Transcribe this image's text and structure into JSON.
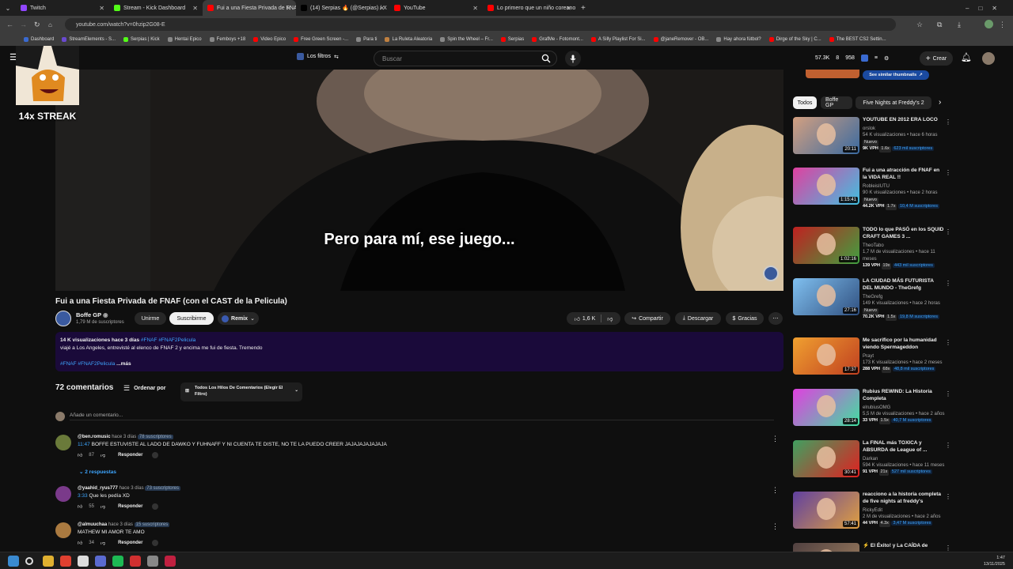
{
  "browser": {
    "tabs": [
      {
        "label": "Twitch",
        "color": "#9146ff"
      },
      {
        "label": "Stream - Kick Dashboard",
        "color": "#53fc18"
      },
      {
        "label": "Fui a una Fiesta Privada de FNAF",
        "color": "#ff0000",
        "active": true
      },
      {
        "label": "(14) Serpias 🔥 (@Serpias) / X",
        "color": "#000000"
      },
      {
        "label": "YouTube",
        "color": "#ff0000"
      },
      {
        "label": "Lo primero que un niño coreano",
        "color": "#ff0000"
      }
    ],
    "url": "youtube.com/watch?v=0hzip2G08-E",
    "bookmarks": [
      "Dashboard",
      "StreamElements - S...",
      "Serpias | Kick",
      "Hentai Epico",
      "Femboys +18",
      "Video Epico",
      "Free Green Screen -...",
      "Para ti",
      "La Ruleta Aleatoria",
      "Spin the Wheel – Fr...",
      "Serpias",
      "GrafMe - Fotomont...",
      "A Silly Playlist For Si...",
      "@janeRemover - OB...",
      "Hay ahora fútbol?",
      "Dirge of the Sky | C...",
      "The BEST CS2 Settin..."
    ]
  },
  "header": {
    "filters": "Los filtros",
    "search_placeholder": "Buscar",
    "stats": {
      "views": "57.3K",
      "n1": "8",
      "n2": "958"
    },
    "create": "Crear"
  },
  "overlay": {
    "streak": "14x STREAK"
  },
  "video": {
    "subtitle": "Pero para mí, ese juego...",
    "title": "Fui a una Fiesta Privada de FNAF (con el CAST de la Pelicula)"
  },
  "channel": {
    "name": "Boffe GP",
    "subs": "1,79 M de suscriptores",
    "join": "Unirme",
    "subscribe": "Suscribirme",
    "remix": "Remix"
  },
  "actions": {
    "likes": "1,6 K",
    "share": "Compartir",
    "download": "Descargar",
    "thanks": "Gracias"
  },
  "description": {
    "views": "14 K visualizaciones",
    "date": "hace 3 días",
    "tags_top": "#FNAF #FNAF2Pelicula",
    "text": "viajé a Los Angeles, entrevisté al elenco de FNAF 2 y encima me fui de fiesta. Tremendo",
    "tags_bottom": "#FNAF #FNAF2Pelicula",
    "more": "...más"
  },
  "comments": {
    "count": "72 comentarios",
    "sort": "Ordenar por",
    "filter": "Todos Los Hilos De Comentarios (Elegir El Filtro)",
    "add": "Añade un comentario...",
    "reply_label": "Responder",
    "items": [
      {
        "user": "@ben.romusic",
        "time": "hace 3 días",
        "subs": "78 suscriptores",
        "stamp": "11:47",
        "text": "BOFFE ESTUVISTE AL LADO DE DAWKO Y FUHNAFF Y NI CUENTA TE DISTE, NO TE LA PUEDO CREER JAJAJAJAJAJAJA",
        "likes": "87",
        "replies": "2 respuestas",
        "color": "#6a7a3a"
      },
      {
        "user": "@yaahid_ryus777",
        "time": "hace 3 días",
        "subs": "73 suscriptores",
        "stamp": "3:33",
        "text": "Que les pedía XD",
        "likes": "55",
        "color": "#7a3a8a"
      },
      {
        "user": "@almuuchaa",
        "time": "hace 3 días",
        "subs": "15 suscriptores",
        "stamp": "",
        "text": "MATHEW MI AMOR TE AMO",
        "likes": "34",
        "color": "#aa7a40"
      }
    ]
  },
  "sidebar": {
    "similar": "See similar thumbnails",
    "chips": [
      "Todos",
      "Boffe GP",
      "Five Nights at Freddy's 2"
    ],
    "videos": [
      {
        "title": "YOUTUBE EN 2012 ERA LOCO",
        "channel": "orslok",
        "meta": "54 K visualizaciones • hace 6 horas",
        "badge": "Nuevo",
        "vph": "9K VPH",
        "mult": "1.6x",
        "subs": "623 mil suscriptores",
        "dur": "20:11",
        "c1": "#d4a080",
        "c2": "#3a6aa0"
      },
      {
        "title": "Fui a una atracción de FNAF en la VIDA REAL !!",
        "channel": "RobleisIUTU",
        "meta": "90 K visualizaciones • hace 2 horas",
        "badge": "Nuevo",
        "vph": "44.2K VPH",
        "mult": "1.7x",
        "subs": "10,4 M suscriptores",
        "dur": "1:15:41",
        "c1": "#e040a0",
        "c2": "#40c0e0"
      },
      {
        "title": "TODO lo que PASÓ en los SQUID CRAFT GAMES 3 ...",
        "channel": "TheoTabo",
        "meta": "1,7 M de visualizaciones • hace 11 meses",
        "badge": "",
        "vph": "139 VPH",
        "mult": "19x",
        "subs": "443 mil suscriptores",
        "dur": "1:02:16",
        "c1": "#c02020",
        "c2": "#40a040"
      },
      {
        "title": "LA CIUDAD MÁS FUTURISTA DEL MUNDO - TheGrefg",
        "channel": "TheGrefg",
        "meta": "149 K visualizaciones • hace 2 horas",
        "badge": "Nuevo",
        "vph": "70.2K VPH",
        "mult": "1.5x",
        "subs": "19,8 M suscriptores",
        "dur": "27:16",
        "c1": "#80c0f0",
        "c2": "#305080"
      },
      {
        "title": "Me sacrifico por la humanidad viendo Spermageddon",
        "channel": "Prayt",
        "meta": "173 K visualizaciones • hace 2 meses",
        "badge": "",
        "vph": "288 VPH",
        "mult": "68x",
        "subs": "48,8 mil suscriptores",
        "dur": "17:37",
        "c1": "#f0a030",
        "c2": "#c04020"
      },
      {
        "title": "Rubius REWIND: La Historia Completa",
        "channel": "elrubiusOMG",
        "meta": "5,5 M de visualizaciones • hace 2 años",
        "badge": "",
        "vph": "33 VPH",
        "mult": "1.5x",
        "subs": "40,7 M suscriptores",
        "dur": "28:14",
        "c1": "#e040e0",
        "c2": "#40e0a0"
      },
      {
        "title": "La FINAL más TOXICA y ABSURDA de League of ...",
        "channel": "Darkan",
        "meta": "594 K visualizaciones • hace 11 meses",
        "badge": "",
        "vph": "91 VPH",
        "mult": "21x",
        "subs": "527 mil suscriptores",
        "dur": "30:41",
        "c1": "#40a060",
        "c2": "#e02020"
      },
      {
        "title": "reacciono a la historia completa de five nights at freddy's",
        "channel": "RickyEdit",
        "meta": "2 M de visualizaciones • hace 2 años",
        "badge": "",
        "vph": "44 VPH",
        "mult": "4.3x",
        "subs": "3,47 M suscriptores",
        "dur": "57:41",
        "c1": "#6040a0",
        "c2": "#e0a040"
      },
      {
        "title": "⚡ El Éxito! y La CAÍDA de",
        "channel": "",
        "meta": "",
        "badge": "",
        "vph": "",
        "mult": "",
        "subs": "",
        "dur": "",
        "c1": "#504040",
        "c2": "#a08060"
      }
    ]
  },
  "taskbar": {
    "time": "1:47",
    "date": "13/11/2025"
  }
}
